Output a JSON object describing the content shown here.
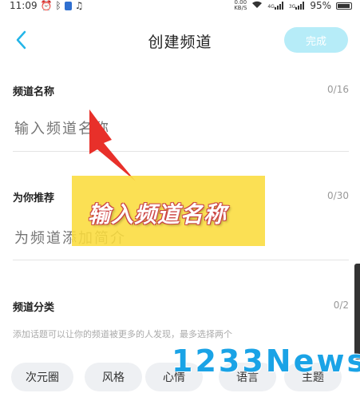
{
  "status_bar": {
    "time": "11:09",
    "net_speed_value": "0.00",
    "net_speed_unit": "KB/S",
    "signal_1": "4G",
    "signal_2": "3G",
    "battery": "95%"
  },
  "header": {
    "title": "创建频道",
    "done_label": "完成"
  },
  "fields": {
    "name": {
      "label": "频道名称",
      "count": "0/16",
      "placeholder": "输入频道名称"
    },
    "recommend": {
      "label": "为你推荐",
      "count": "0/30",
      "placeholder": "为频道添加简介"
    },
    "category": {
      "label": "频道分类",
      "count": "0/2",
      "hint": "添加话题可以让你的频道被更多的人发现，最多选择两个"
    }
  },
  "tags": [
    "次元圈",
    "风格",
    "心情",
    "语言",
    "主题"
  ],
  "overlay": {
    "banner_text": "输入频道名称",
    "banner_color": "#fadc3c",
    "arrow_color": "#e8302a"
  },
  "watermark": "1233News",
  "colors": {
    "accent": "#23b5e8",
    "done_button_disabled": "#b6ecf8"
  }
}
